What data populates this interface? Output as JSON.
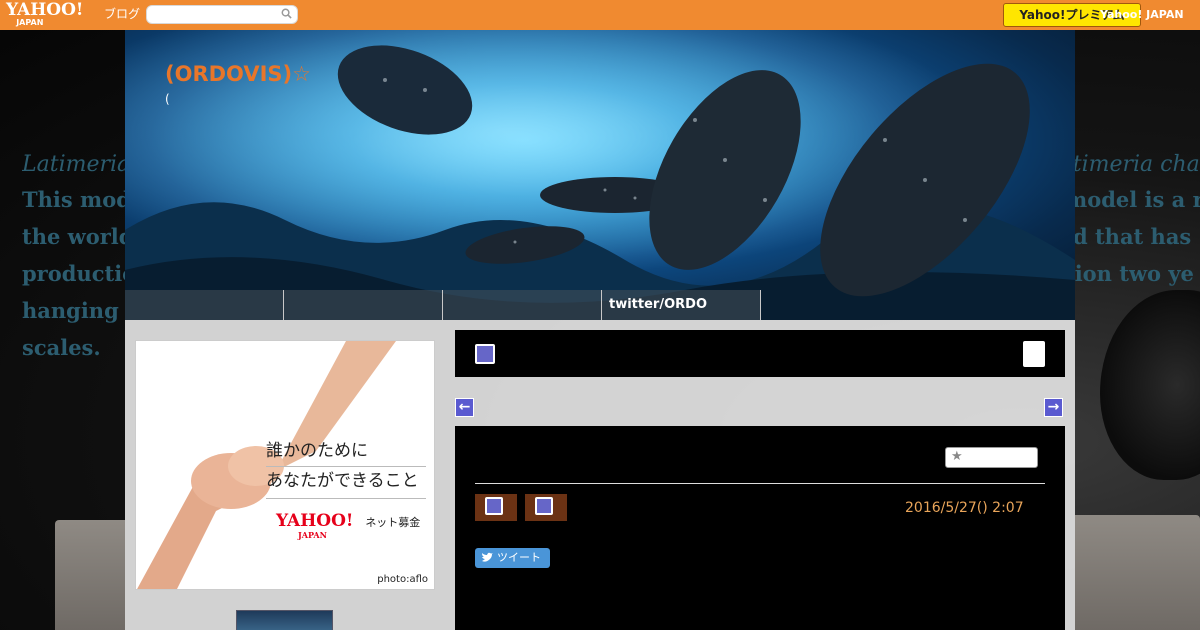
{
  "topbar": {
    "logo_text": "YAHOO!",
    "logo_sub": "JAPAN",
    "logo_service": "ブログ",
    "search_placeholder": "",
    "premium_label": "Yahoo!プレミアム",
    "yahoo_japan_link": "Yahoo! JAPAN"
  },
  "background": {
    "left_italic": "Latimeria chalumnae",
    "left_lines": [
      "This model is a rare",
      "the world that has",
      " production two years",
      " hanging",
      "scales."
    ],
    "right_italic": "Latimeria chalumnae",
    "right_lines": [
      "model is a rare",
      "ld that has",
      "tion two ye",
      "",
      ""
    ]
  },
  "header": {
    "blog_title": "(ORDOVIS)☆",
    "blog_subtitle": "(",
    "nav_tabs": [
      "",
      "",
      "",
      "twitter/ORDO"
    ]
  },
  "sidebar": {
    "ad_line1": "誰かのために",
    "ad_line2": "あなたができること",
    "ad_brand": "YAHOO!",
    "ad_brand_sub": "JAPAN",
    "ad_service": "ネット募金",
    "ad_credit": "photo:aflo"
  },
  "article": {
    "date": "2016/5/27()  2:07",
    "tweet_label": "ツイート"
  },
  "colors": {
    "topbar": "#f08a30",
    "title": "#e8762a",
    "date": "#e9a55a",
    "icon": "#6666c8"
  }
}
